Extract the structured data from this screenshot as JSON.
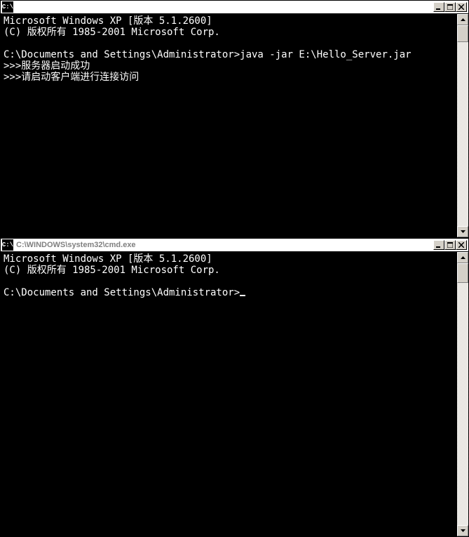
{
  "windows": [
    {
      "title": "",
      "icon_label": "C:\\",
      "lines": [
        "Microsoft Windows XP [版本 5.1.2600]",
        "(C) 版权所有 1985-2001 Microsoft Corp.",
        "",
        "C:\\Documents and Settings\\Administrator>java -jar E:\\Hello_Server.jar",
        ">>>服务器启动成功",
        ">>>请启动客户端进行连接访问"
      ],
      "has_cursor": false,
      "thumb_height": 24
    },
    {
      "title": "C:\\WINDOWS\\system32\\cmd.exe",
      "icon_label": "C:\\",
      "lines": [
        "Microsoft Windows XP [版本 5.1.2600]",
        "(C) 版权所有 1985-2001 Microsoft Corp.",
        "",
        "C:\\Documents and Settings\\Administrator>"
      ],
      "has_cursor": true,
      "thumb_height": 28
    }
  ],
  "buttons": {
    "minimize": "minimize",
    "maximize": "maximize",
    "close": "close"
  }
}
